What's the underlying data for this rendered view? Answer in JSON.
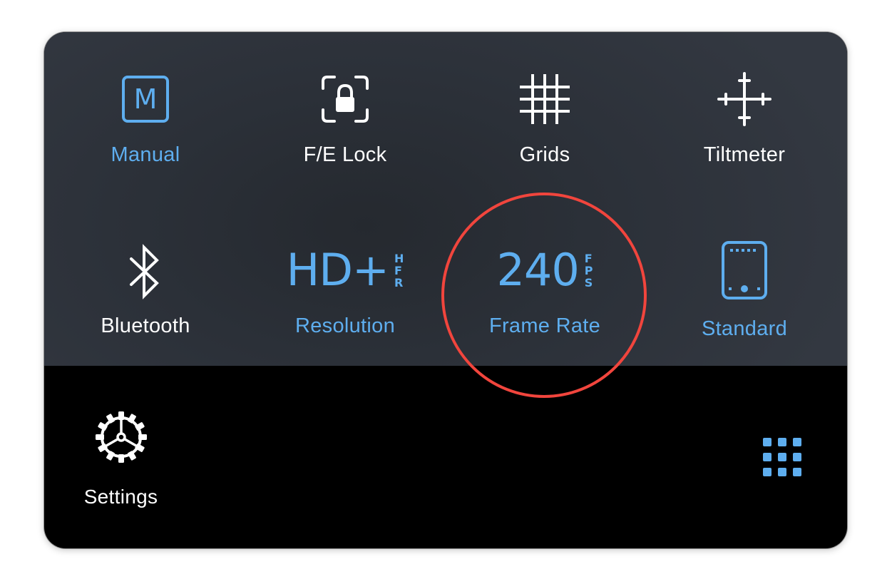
{
  "tiles": [
    {
      "label": "Manual",
      "icon_letter": "M",
      "active": true
    },
    {
      "label": "F/E Lock",
      "active": false
    },
    {
      "label": "Grids",
      "active": false
    },
    {
      "label": "Tiltmeter",
      "active": false
    },
    {
      "label": "Bluetooth",
      "active": false
    },
    {
      "label": "Resolution",
      "big": "HD+",
      "stack": [
        "H",
        "F",
        "R"
      ],
      "active": true
    },
    {
      "label": "Frame Rate",
      "big": "240",
      "stack": [
        "F",
        "P",
        "S"
      ],
      "active": true
    },
    {
      "label": "Standard",
      "active": true
    }
  ],
  "footer": {
    "settings_label": "Settings"
  },
  "colors": {
    "accent": "#5eaeef",
    "highlight_ring": "#f1453d"
  },
  "icons": {
    "manual": "manual-mode-icon",
    "fe_lock": "lock-icon",
    "grids": "grid-icon",
    "tiltmeter": "crosshair-icon",
    "bluetooth": "bluetooth-icon",
    "standard": "device-frame-icon",
    "settings": "gear-icon",
    "more": "apps-grid-icon"
  }
}
